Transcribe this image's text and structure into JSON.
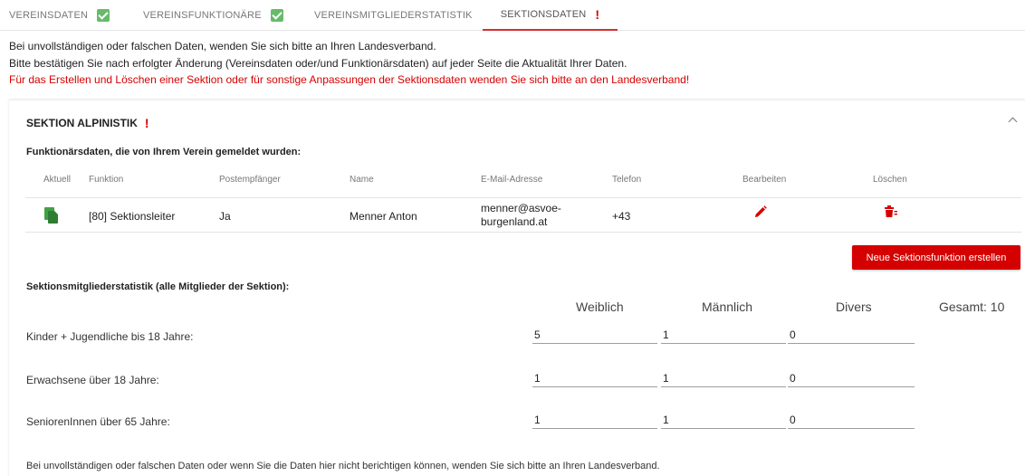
{
  "tabs": [
    {
      "label": "Vereinsdaten",
      "status": "complete"
    },
    {
      "label": "Vereinsfunktionäre",
      "status": "complete"
    },
    {
      "label": "Vereinsmitgliederstatistik",
      "status": "none"
    },
    {
      "label": "Sektionsdaten",
      "status": "incomplete",
      "active": true
    }
  ],
  "notices": [
    "Bei unvollständigen oder falschen Daten, wenden Sie sich bitte an Ihren Landesverband.",
    "Bitte bestätigen Sie nach erfolgter Änderung (Vereinsdaten oder/und Funktionärsdaten) auf jeder Seite die Aktualität Ihrer Daten.",
    "Für das Erstellen und Löschen einer Sektion oder für sonstige Anpassungen der Sektionsdaten wenden Sie sich bitte an den Landesverband!"
  ],
  "section": {
    "title": "SEKTION ALPINISTIK",
    "warning_mark": "!",
    "functionaries_heading": "Funktionärsdaten, die von Ihrem Verein gemeldet wurden:",
    "table": {
      "headers": [
        "Aktuell",
        "Funktion",
        "Postempfänger",
        "Name",
        "E-Mail-Adresse",
        "Telefon",
        "Bearbeiten",
        "Löschen"
      ],
      "rows": [
        {
          "funktion": "[80] Sektionsleiter",
          "postempfaenger": "Ja",
          "name": "Menner Anton",
          "email_line1": "menner@asvoe-",
          "email_line2": "burgenland.at",
          "telefon": "+43"
        }
      ]
    },
    "new_button": "Neue Sektionsfunktion erstellen",
    "stats_heading": "Sektionsmitgliederstatistik (alle Mitglieder der Sektion):",
    "stats": {
      "columns": [
        "Weiblich",
        "Männlich",
        "Divers"
      ],
      "total_label": "Gesamt: 10",
      "rows": [
        {
          "label": "Kinder + Jugendliche bis 18 Jahre:",
          "values": [
            "5",
            "1",
            "0"
          ]
        },
        {
          "label": "Erwachsene über 18 Jahre:",
          "values": [
            "1",
            "1",
            "0"
          ]
        },
        {
          "label": "SeniorenInnen über 65 Jahre:",
          "values": [
            "1",
            "1",
            "0"
          ]
        }
      ]
    },
    "footer_note": "Bei unvollständigen oder falschen Daten oder wenn Sie die Daten hier nicht berichtigen können, wenden Sie sich bitte an Ihren Landesverband."
  },
  "colors": {
    "accent": "#d50000",
    "success": "#66bb6a"
  },
  "icons": {
    "complete": "check-icon",
    "incomplete": "exclamation-icon",
    "current": "document-copy-icon",
    "edit": "pencil-icon",
    "delete": "trash-icon",
    "collapse": "chevron-up-icon"
  }
}
